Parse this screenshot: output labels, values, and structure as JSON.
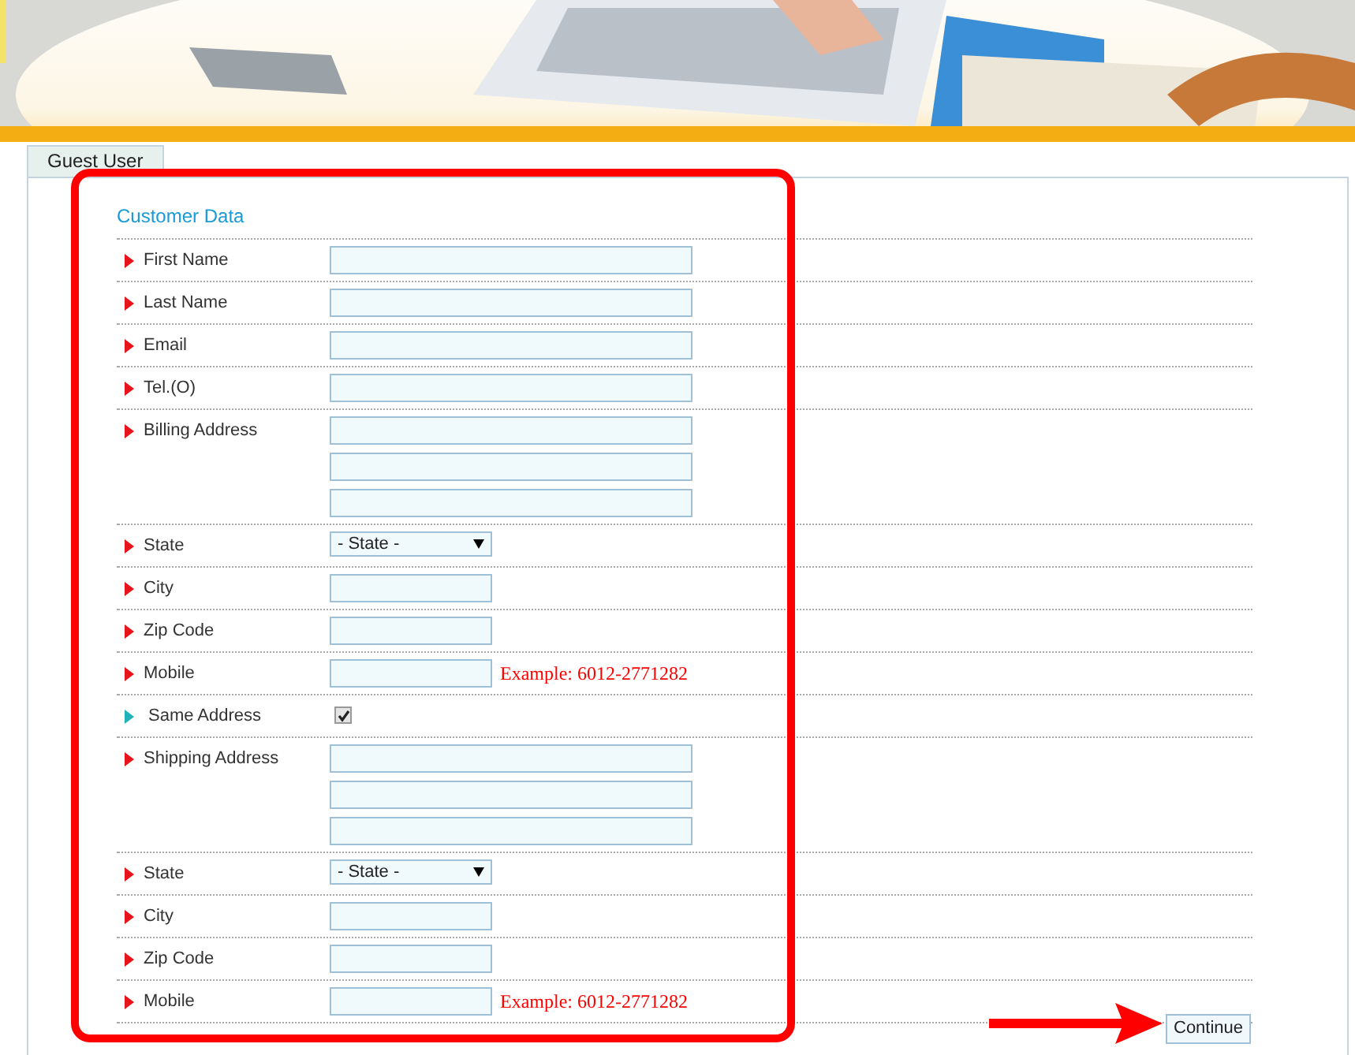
{
  "tabs": [
    {
      "label": "Guest User",
      "selected": true
    }
  ],
  "section_title": "Customer Data",
  "fields": [
    {
      "kind": "text",
      "label": "First Name",
      "color": "#e8141b"
    },
    {
      "kind": "text",
      "label": "Last Name",
      "color": "#e8141b"
    },
    {
      "kind": "text",
      "label": "Email",
      "color": "#e8141b"
    },
    {
      "kind": "text",
      "label": "Tel.(O)",
      "color": "#e8141b"
    },
    {
      "kind": "address",
      "label": "Billing Address",
      "color": "#e8141b"
    },
    {
      "kind": "select",
      "label": "State",
      "color": "#e8141b",
      "value": "- State -"
    },
    {
      "kind": "short",
      "label": "City",
      "color": "#e8141b"
    },
    {
      "kind": "short",
      "label": "Zip Code",
      "color": "#e8141b"
    },
    {
      "kind": "short",
      "label": "Mobile",
      "color": "#e8141b",
      "hint": "Example: 6012-2771282"
    },
    {
      "kind": "checkbox",
      "label": "Same Address",
      "color": "#20b2b8",
      "checked": true
    },
    {
      "kind": "address",
      "label": "Shipping Address",
      "color": "#e8141b"
    },
    {
      "kind": "select",
      "label": "State",
      "color": "#e8141b",
      "value": "- State -"
    },
    {
      "kind": "short",
      "label": "City",
      "color": "#e8141b"
    },
    {
      "kind": "short",
      "label": "Zip Code",
      "color": "#e8141b"
    },
    {
      "kind": "short",
      "label": "Mobile",
      "color": "#e8141b",
      "hint": "Example: 6012-2771282"
    }
  ],
  "continue_button": "Continue"
}
